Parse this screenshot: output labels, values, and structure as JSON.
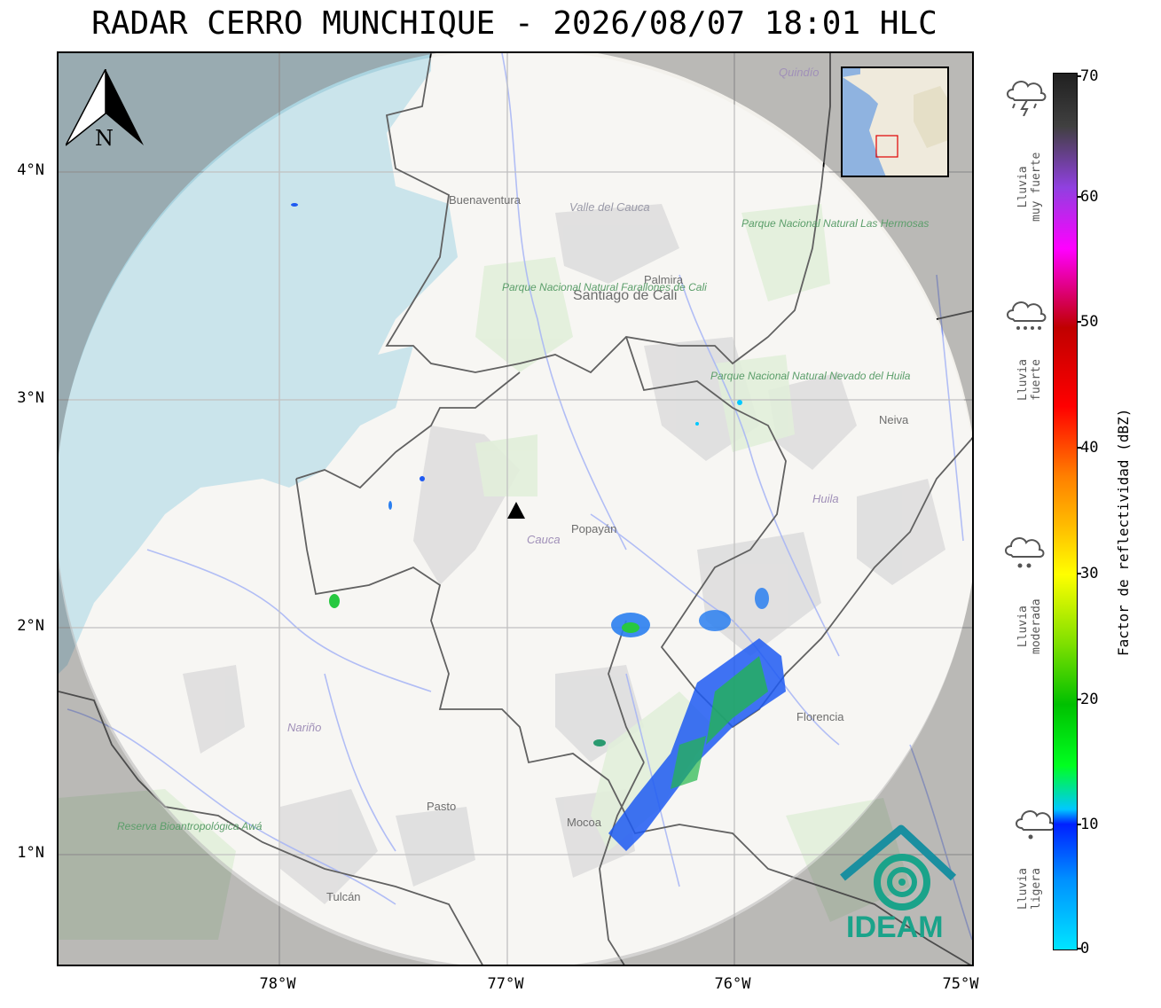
{
  "header": {
    "title": "RADAR CERRO MUNCHIQUE - 2026/08/07 18:01 HLC"
  },
  "map": {
    "lat_ticks": [
      "4°N",
      "3°N",
      "2°N",
      "1°N"
    ],
    "lon_ticks": [
      "78°W",
      "77°W",
      "76°W",
      "75°W"
    ],
    "radar_marker": "radar-site-triangle",
    "north_label": "N",
    "places": {
      "buenaventura": "Buenaventura",
      "valle": "Valle del Cauca",
      "palmira": "Palmira",
      "cali": "Santiago de Cali",
      "farallones": "Parque Nacional Natural Farallones de Cali",
      "hermosas": "Parque Nacional Natural Las Hermosas",
      "nevado": "Parque Nacional Natural Nevado del Huila",
      "popayan": "Popayán",
      "cauca": "Cauca",
      "huila": "Huila",
      "neiva": "Neiva",
      "florencia": "Florencia",
      "narino": "Nariño",
      "pasto": "Pasto",
      "mocoa": "Mocoa",
      "tulcan": "Tulcán",
      "quindio": "Quindío",
      "awa": "Reserva Bioantropológica Awá"
    }
  },
  "logo": {
    "text": "IDEAM"
  },
  "colorbar": {
    "label": "Factor de reflectividad (dBZ)",
    "ticks": [
      "70",
      "60",
      "50",
      "40",
      "30",
      "20",
      "10",
      "0"
    ],
    "min": 0,
    "max": 70
  },
  "rain_levels": [
    {
      "label": "Lluvia\nmuy fuerte",
      "icon": "thunderstorm-icon"
    },
    {
      "label": "Lluvia\nfuerte",
      "icon": "heavy-rain-icon"
    },
    {
      "label": "Lluvia\nmoderada",
      "icon": "moderate-rain-icon"
    },
    {
      "label": "Lluvia\nligera",
      "icon": "light-rain-icon"
    }
  ],
  "colors": {
    "coverage_mask": "#e4e4e4",
    "ocean": "#aad3df",
    "border": "#000000",
    "river": "#6f86f0",
    "logo": "#1a9a8a"
  }
}
